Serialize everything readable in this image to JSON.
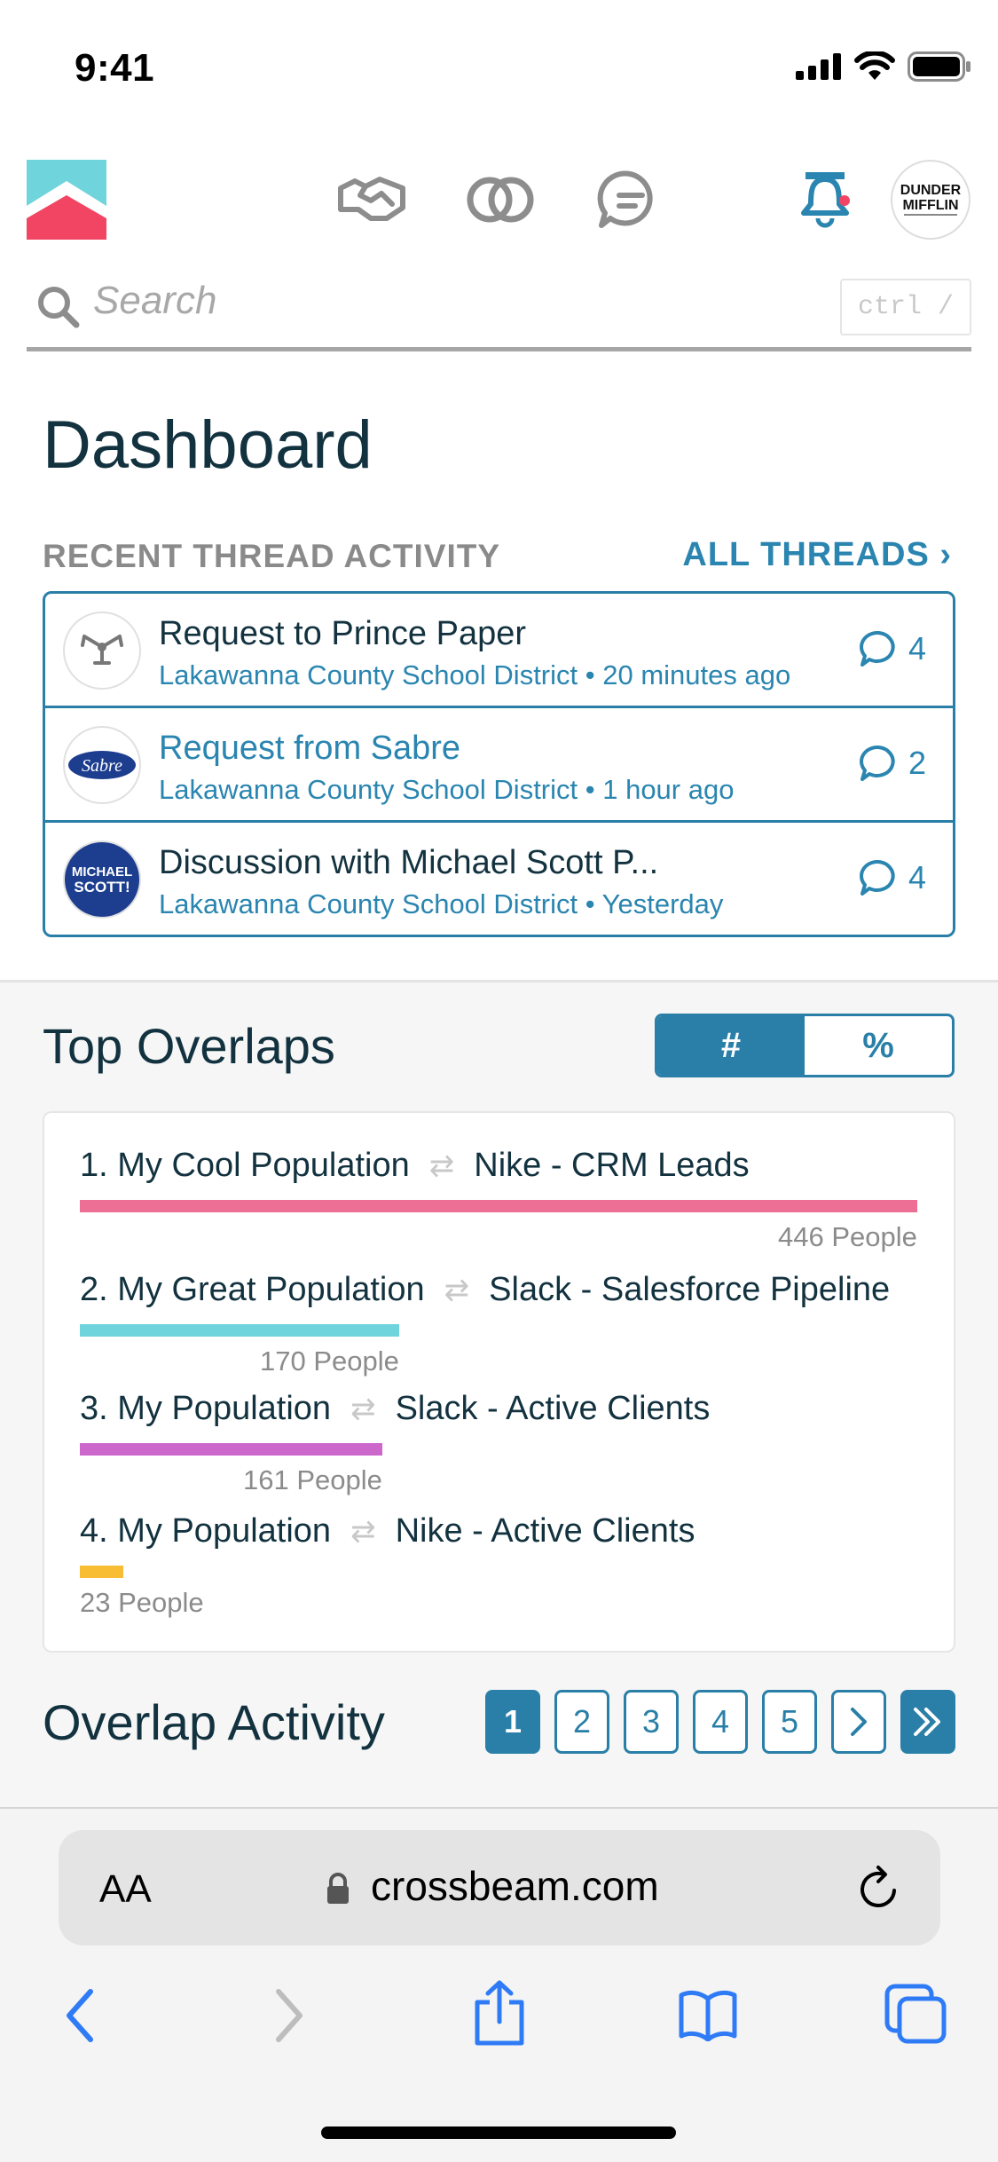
{
  "status": {
    "time": "9:41"
  },
  "search": {
    "placeholder": "Search",
    "shortcut": "ctrl /"
  },
  "page": {
    "title": "Dashboard"
  },
  "threads_section": {
    "label": "RECENT THREAD ACTIVITY",
    "link": "ALL THREADS ›",
    "items": [
      {
        "title": "Request to Prince Paper",
        "org": "Lakawanna County School District",
        "when": " • 20 minutes ago",
        "count": "4"
      },
      {
        "title": "Request from Sabre",
        "org": "Lakawanna County School District",
        "when": " • 1 hour ago",
        "count": "2"
      },
      {
        "title": "Discussion with Michael Scott P...",
        "org": "Lakawanna County School District",
        "when": " • Yesterday",
        "count": "4"
      }
    ]
  },
  "overlaps": {
    "title": "Top Overlaps",
    "toggle": {
      "count": "#",
      "percent": "%"
    },
    "items": [
      {
        "rank": "1. My Cool Population",
        "partner": "Nike - CRM Leads",
        "people": "446 People",
        "value": 446,
        "color": "#ee6f95"
      },
      {
        "rank": "2. My Great Population",
        "partner": "Slack - Salesforce Pipeline",
        "people": "170 People",
        "value": 170,
        "color": "#6fd4dc"
      },
      {
        "rank": "3. My Population",
        "partner": "Slack - Active Clients",
        "people": "161 People",
        "value": 161,
        "color": "#cc68cc"
      },
      {
        "rank": "4. My Population",
        "partner": "Nike - Active Clients",
        "people": "23 People",
        "value": 23,
        "color": "#f8bd33"
      }
    ]
  },
  "activity": {
    "title": "Overlap Activity",
    "pages": [
      "1",
      "2",
      "3",
      "4",
      "5"
    ],
    "next": "›",
    "last": "»"
  },
  "browser": {
    "aa": "AA",
    "url": "crossbeam.com"
  },
  "colors": {
    "accent": "#2a7fa8",
    "text": "#13323f"
  }
}
